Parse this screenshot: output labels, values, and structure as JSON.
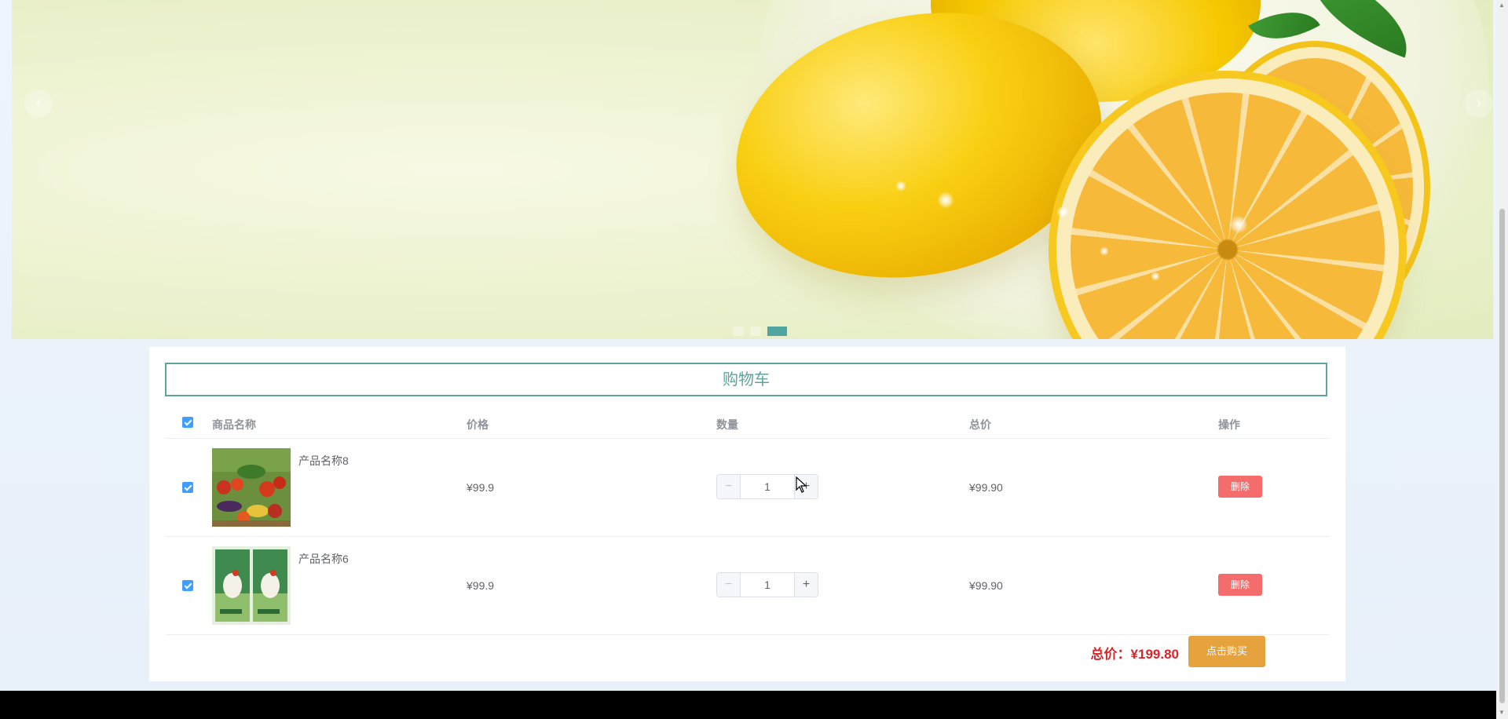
{
  "banner": {
    "prev_icon": "‹",
    "next_icon": "›",
    "dots": [
      {
        "active": false
      },
      {
        "active": false
      },
      {
        "active": true
      }
    ]
  },
  "cart": {
    "title": "购物车",
    "columns": {
      "name": "商品名称",
      "price": "价格",
      "quantity": "数量",
      "total": "总价",
      "action": "操作"
    },
    "items": [
      {
        "name": "产品名称8",
        "price": "¥99.9",
        "quantity": "1",
        "total": "¥99.90",
        "delete_label": "删除",
        "image": "vegetables-photo"
      },
      {
        "name": "产品名称6",
        "price": "¥99.9",
        "quantity": "1",
        "total": "¥99.90",
        "delete_label": "删除",
        "image": "package-photo"
      }
    ],
    "grand_total": "总价：¥199.80",
    "buy_label": "点击购买",
    "minus_icon": "−",
    "plus_icon": "+"
  },
  "colors": {
    "accent": "#5ea39c",
    "checkbox": "#409eff",
    "delete": "#f56c6c",
    "buy": "#e6a23c",
    "total_text": "#d6262a"
  }
}
